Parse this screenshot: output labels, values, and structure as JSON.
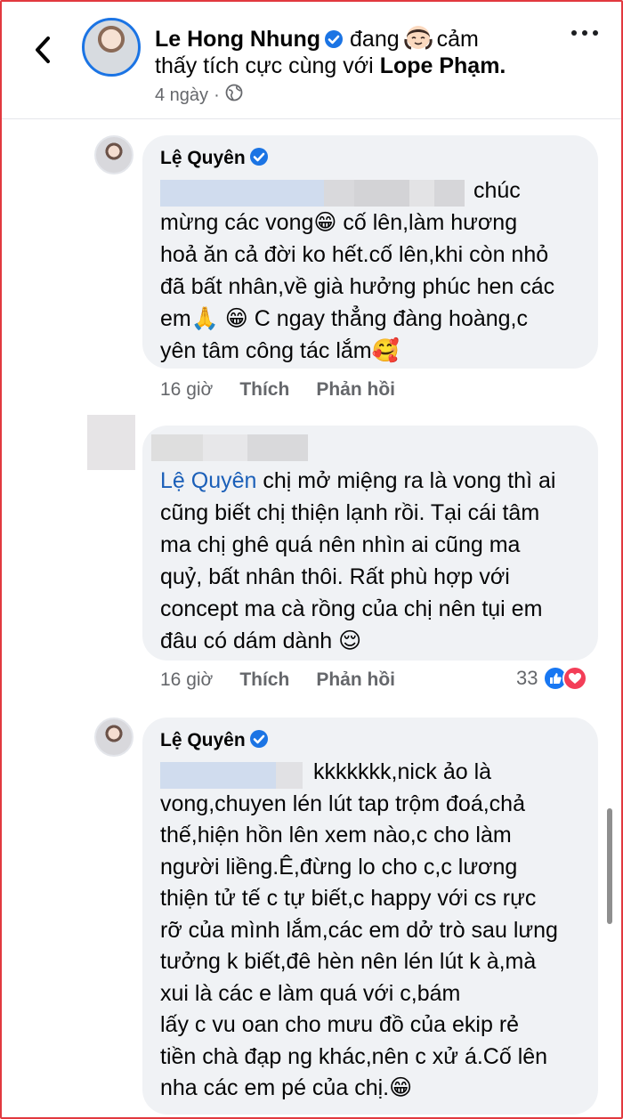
{
  "post": {
    "author": "Le Hong Nhung",
    "feeling_prefix": "đang",
    "feeling_text": "cảm",
    "line2_text": "thấy tích cực cùng với",
    "tagged": "Lope Phạm.",
    "time": "4 ngày"
  },
  "comments": [
    {
      "name": "Lệ Quyên",
      "lines": [
        "chúc",
        "mừng các vong😁 cố lên,làm hương",
        "hoả ăn cả đời ko hết.cố lên,khi còn nhỏ",
        "đã bất nhân,về già hưởng phúc hen các",
        "em🙏 😁 C ngay thẳng đàng hoàng,c",
        "yên tâm công tác lắm🥰"
      ],
      "time": "16 giờ",
      "like": "Thích",
      "reply": "Phản hồi"
    },
    {
      "mention": "Lệ Quyên",
      "lines": [
        "chị mở miệng ra là vong thì ai",
        "cũng biết chị thiện lạnh rồi. Tại cái tâm",
        "ma chị ghê quá nên nhìn ai cũng ma",
        "quỷ, bất nhân thôi. Rất phù hợp với",
        "concept ma cà rồng của chị nên tụi em",
        "đâu có dám dành 😌"
      ],
      "time": "16 giờ",
      "like": "Thích",
      "reply": "Phản hồi",
      "reaction_count": "33"
    },
    {
      "name": "Lệ Quyên",
      "lines": [
        "kkkkkkk,nick ảo là",
        "vong,chuyen lén lút tap trộm đoá,chả",
        "thế,hiện hồn lên xem nào,c cho làm",
        "người liềng.Ê,đừng lo cho c,c lương",
        "thiện tử tế c tự biết,c happy với cs rực",
        "rỡ của mình lắm,các em dở trò sau lưng",
        "tưởng k biết,đê hèn nên lén lút k à,mà",
        "xui là các e làm quá với c,bám",
        "lấy c vu oan cho mưu đồ của ekip rẻ",
        "tiền chà đạp ng khác,nên c xử á.Cố lên",
        "nha các em pé của chị.😁"
      ]
    }
  ],
  "colors": {
    "frame": "#e2393f",
    "verified": "#1b74e4",
    "like_blue": "#1877f2",
    "love_red": "#f33e58",
    "bubble": "#f0f2f5",
    "mention": "#1b5fb8"
  },
  "icons": [
    "back-arrow-icon",
    "verified-badge-icon",
    "feeling-emoji-icon",
    "globe-icon",
    "more-dots-icon",
    "like-reaction-icon",
    "love-reaction-icon"
  ]
}
